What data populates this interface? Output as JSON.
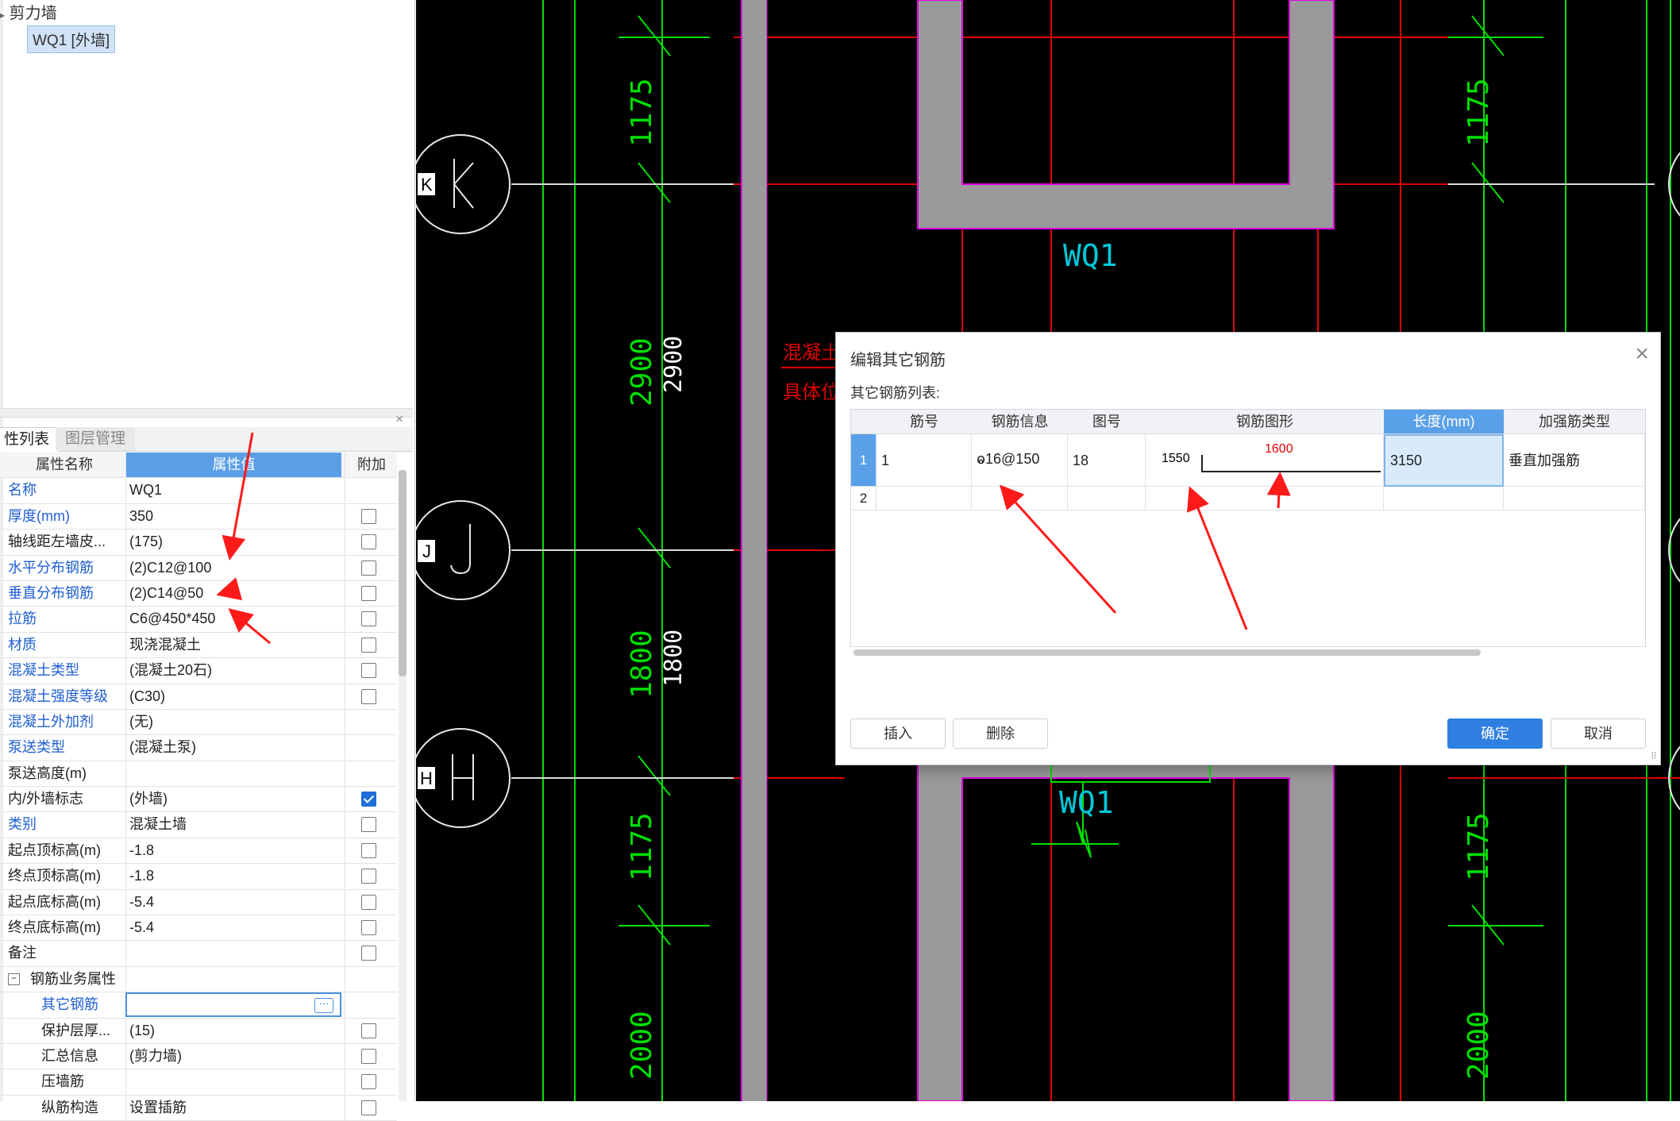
{
  "tree": {
    "parent_label": "剪力墙",
    "selected_item": "WQ1 [外墙]"
  },
  "panel": {
    "close_glyph": "×",
    "tabs": [
      "性列表",
      "图层管理"
    ],
    "headers": {
      "name": "属性名称",
      "value": "属性值",
      "add": "附加"
    }
  },
  "properties": [
    {
      "name": "名称",
      "value": "WQ1",
      "blue": true,
      "checkbox": null
    },
    {
      "name": "厚度(mm)",
      "value": "350",
      "blue": true,
      "checkbox": false
    },
    {
      "name": "轴线距左墙皮...",
      "value": "(175)",
      "blue": false,
      "checkbox": false
    },
    {
      "name": "水平分布钢筋",
      "value": "(2)C12@100",
      "blue": true,
      "checkbox": false
    },
    {
      "name": "垂直分布钢筋",
      "value": "(2)C14@50",
      "blue": true,
      "checkbox": false
    },
    {
      "name": "拉筋",
      "value": "C6@450*450",
      "blue": true,
      "checkbox": false
    },
    {
      "name": "材质",
      "value": "现浇混凝土",
      "blue": true,
      "checkbox": false
    },
    {
      "name": "混凝土类型",
      "value": "(混凝土20石)",
      "blue": true,
      "checkbox": false
    },
    {
      "name": "混凝土强度等级",
      "value": "(C30)",
      "blue": true,
      "checkbox": false
    },
    {
      "name": "混凝土外加剂",
      "value": "(无)",
      "blue": true,
      "checkbox": null
    },
    {
      "name": "泵送类型",
      "value": "(混凝土泵)",
      "blue": true,
      "checkbox": null
    },
    {
      "name": "泵送高度(m)",
      "value": "",
      "blue": false,
      "checkbox": null
    },
    {
      "name": "内/外墙标志",
      "value": "(外墙)",
      "blue": false,
      "checkbox": true
    },
    {
      "name": "类别",
      "value": "混凝土墙",
      "blue": true,
      "checkbox": false
    },
    {
      "name": "起点顶标高(m)",
      "value": "-1.8",
      "blue": false,
      "checkbox": false
    },
    {
      "name": "终点顶标高(m)",
      "value": "-1.8",
      "blue": false,
      "checkbox": false
    },
    {
      "name": "起点底标高(m)",
      "value": "-5.4",
      "blue": false,
      "checkbox": false
    },
    {
      "name": "终点底标高(m)",
      "value": "-5.4",
      "blue": false,
      "checkbox": false
    },
    {
      "name": "备注",
      "value": "",
      "blue": false,
      "checkbox": false
    },
    {
      "name": "钢筋业务属性",
      "value": "",
      "blue": false,
      "checkbox": null,
      "group": true,
      "expander": "−"
    },
    {
      "name": "其它钢筋",
      "value": "",
      "blue": true,
      "checkbox": null,
      "indent": true,
      "editing": true,
      "button": "···"
    },
    {
      "name": "保护层厚...",
      "value": "(15)",
      "blue": false,
      "checkbox": false,
      "indent": true
    },
    {
      "name": "汇总信息",
      "value": "(剪力墙)",
      "blue": false,
      "checkbox": false,
      "indent": true
    },
    {
      "name": "压墙筋",
      "value": "",
      "blue": false,
      "checkbox": false,
      "indent": true
    },
    {
      "name": "纵筋构造",
      "value": "设置插筋",
      "blue": false,
      "checkbox": false,
      "indent": true
    }
  ],
  "cad": {
    "axis_labels": [
      "K",
      "J",
      "H"
    ],
    "wall_labels": [
      "WQ1",
      "WQ1"
    ],
    "dims_green": [
      "1175",
      "2900",
      "1800",
      "1175",
      "2000",
      "1175",
      "1175",
      "2000"
    ],
    "dims_white": [
      "2900",
      "1800"
    ],
    "note_lines": [
      "混凝土防火",
      "具体位置根"
    ],
    "colors": {
      "green": "#00e000",
      "red": "#e00000",
      "wall_fill": "#9a9a9a",
      "magenta": "#e000e0",
      "cyan": "#00c8d8"
    }
  },
  "dialog": {
    "title": "编辑其它钢筋",
    "close_glyph": "×",
    "subtitle": "其它钢筋列表:",
    "columns": [
      "筋号",
      "钢筋信息",
      "图号",
      "钢筋图形",
      "长度(mm)",
      "加强筋类型"
    ],
    "rows": [
      {
        "num": "1",
        "bar_no": "1",
        "bar_info": "ⱺ16@150",
        "fig_no": "18",
        "shape_left": "1550",
        "shape_top": "1600",
        "length": "3150",
        "type": "垂直加强筋"
      },
      {
        "num": "2",
        "bar_no": "",
        "bar_info": "",
        "fig_no": "",
        "shape_left": "",
        "shape_top": "",
        "length": "",
        "type": ""
      }
    ],
    "buttons": {
      "insert": "插入",
      "delete": "删除",
      "ok": "确定",
      "cancel": "取消"
    },
    "resize_glyph": "⠿"
  }
}
